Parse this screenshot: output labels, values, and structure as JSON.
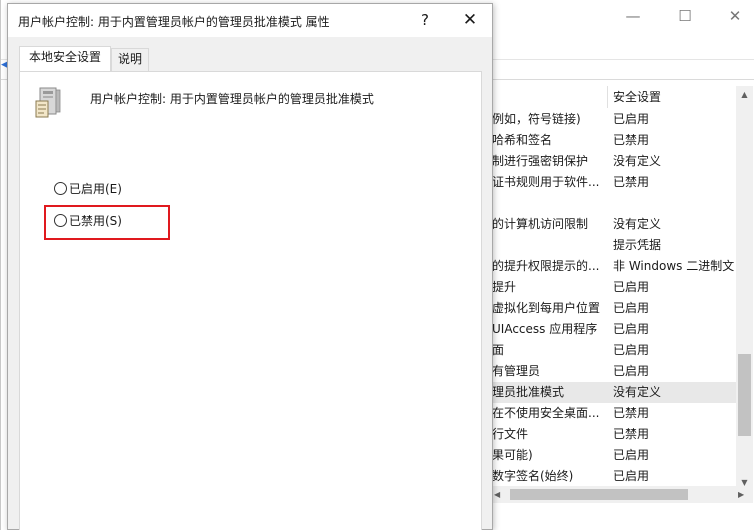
{
  "background_window": {
    "controls": {
      "minimize": "—",
      "maximize": "☐",
      "close": "✕"
    },
    "list": {
      "header_setting": "安全设置",
      "rows": [
        {
          "name": "例如，符号链接)",
          "setting": "已启用"
        },
        {
          "name": "哈希和签名",
          "setting": "已禁用"
        },
        {
          "name": "制进行强密钥保护",
          "setting": "没有定义"
        },
        {
          "name": "证书规则用于软件...",
          "setting": "已禁用"
        },
        {
          "name": "",
          "setting": ""
        },
        {
          "name": "的计算机访问限制",
          "setting": "没有定义"
        },
        {
          "name": "",
          "setting": "提示凭据"
        },
        {
          "name": "的提升权限提示的...",
          "setting": "非 Windows 二进制文"
        },
        {
          "name": "提升",
          "setting": "已启用"
        },
        {
          "name": "虚拟化到每用户位置",
          "setting": "已启用"
        },
        {
          "name": "UIAccess 应用程序",
          "setting": "已启用"
        },
        {
          "name": "面",
          "setting": "已启用"
        },
        {
          "name": "有管理员",
          "setting": "已启用"
        },
        {
          "name": "理员批准模式",
          "setting": "没有定义"
        },
        {
          "name": "在不使用安全桌面...",
          "setting": "已禁用"
        },
        {
          "name": "行文件",
          "setting": "已禁用"
        },
        {
          "name": "果可能)",
          "setting": "已启用"
        },
        {
          "name": "数字签名(始终)",
          "setting": "已启用"
        }
      ],
      "selected_index": 13
    }
  },
  "dialog": {
    "title": "用户帐户控制: 用于内置管理员帐户的管理员批准模式 属性",
    "help_glyph": "?",
    "close_glyph": "✕",
    "tabs": [
      {
        "label": "本地安全设置",
        "active": true
      },
      {
        "label": "说明",
        "active": false
      }
    ],
    "panel": {
      "heading": "用户帐户控制: 用于内置管理员帐户的管理员批准模式",
      "options": [
        {
          "label": "已启用(E)",
          "checked": false
        },
        {
          "label": "已禁用(S)",
          "checked": false,
          "highlighted": true
        }
      ]
    }
  },
  "colors": {
    "highlight": "#e0191e",
    "selected_row": "#e8e8e8",
    "dialog_bg": "#f0f0f0"
  }
}
